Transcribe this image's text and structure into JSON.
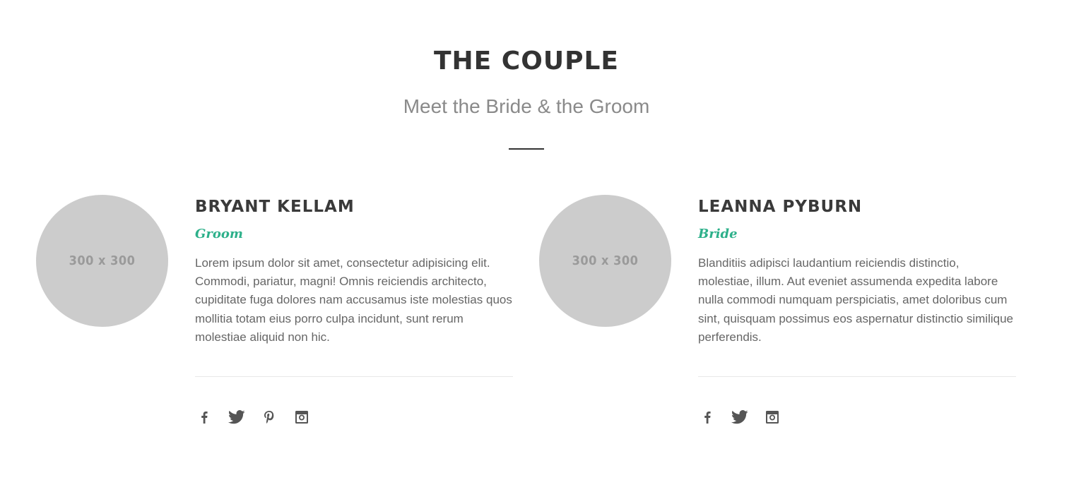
{
  "section": {
    "title": "THE COUPLE",
    "subtitle": "Meet the Bride & the Groom"
  },
  "people": [
    {
      "name": "BRYANT KELLAM",
      "role": "Groom",
      "photo_placeholder": "300 x 300",
      "bio": "Lorem ipsum dolor sit amet, consectetur adipisicing elit. Commodi, pariatur, magni! Omnis reiciendis architecto, cupiditate fuga dolores nam accusamus iste molestias quos mollitia totam eius porro culpa incidunt, sunt rerum molestiae aliquid non hic.",
      "social_icons": [
        "facebook-icon",
        "twitter-icon",
        "pinterest-icon",
        "instagram-icon"
      ]
    },
    {
      "name": "LEANNA PYBURN",
      "role": "Bride",
      "photo_placeholder": "300 x 300",
      "bio": "Blanditiis adipisci laudantium reiciendis distinctio, molestiae, illum. Aut eveniet assumenda expedita labore nulla commodi numquam perspiciatis, amet doloribus cum sint, quisquam possimus eos aspernatur distinctio similique perferendis.",
      "social_icons": [
        "facebook-icon",
        "twitter-icon",
        "instagram-icon"
      ]
    }
  ],
  "colors": {
    "accent": "#2db08a",
    "heading": "#333333",
    "text": "#666666",
    "placeholder": "#cccccc"
  }
}
